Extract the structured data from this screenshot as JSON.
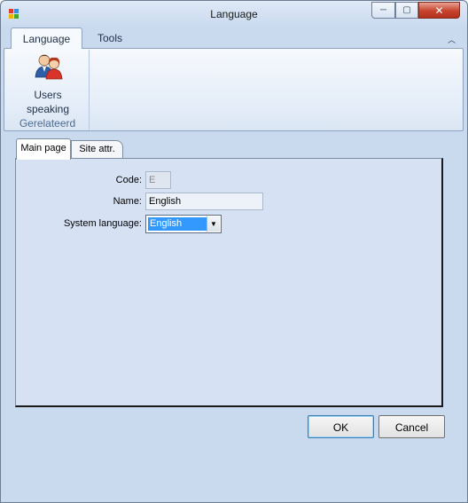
{
  "window": {
    "title": "Language"
  },
  "titlebar_buttons": {
    "minimize": "─",
    "maximize": "▢",
    "close": "✕"
  },
  "ribbon": {
    "tabs": [
      {
        "label": "Language",
        "active": true
      },
      {
        "label": "Tools",
        "active": false
      }
    ],
    "collapse_glyph": "︿",
    "groups": [
      {
        "label": "Gerelateerd",
        "buttons": [
          {
            "label": "Users\nspeaking",
            "icon": "users-icon"
          }
        ]
      }
    ]
  },
  "tabs": [
    {
      "label": "Main page",
      "active": true
    },
    {
      "label": "Site attr.",
      "active": false
    }
  ],
  "form": {
    "code": {
      "label": "Code:",
      "value": "E"
    },
    "name": {
      "label": "Name:",
      "value": "English"
    },
    "system_language": {
      "label": "System language:",
      "value": "English",
      "arrow": "▼"
    }
  },
  "buttons": {
    "ok": "OK",
    "cancel": "Cancel"
  },
  "colors": {
    "window_bg": "#c9d9ee",
    "selection": "#3399ff",
    "close_button": "#c7432c"
  }
}
